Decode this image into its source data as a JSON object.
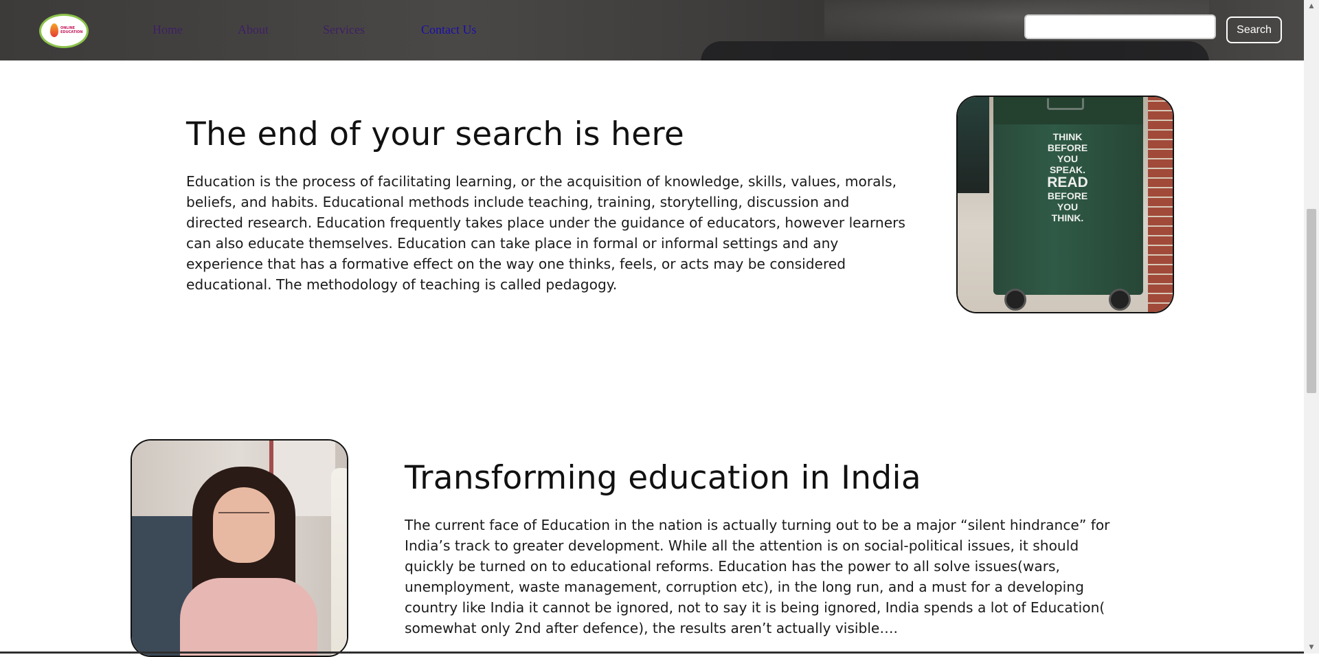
{
  "header": {
    "logo": {
      "lines": [
        "ONLINE",
        "EDUCATION"
      ]
    },
    "nav": {
      "home": "Home",
      "about": "About",
      "services": "Services",
      "contact": "Contact Us"
    },
    "search": {
      "value": "",
      "placeholder": "",
      "button_label": "Search"
    }
  },
  "sections": [
    {
      "title": "The end of your search is here",
      "text": "Education is the process of facilitating learning, or the acquisition of knowledge, skills, values, morals, beliefs, and habits. Educational methods include teaching, training, storytelling, discussion and directed research. Education frequently takes place under the guidance of educators, however learners can also educate themselves. Education can take place in formal or informal settings and any experience that has a formative effect on the way one thinks, feels, or acts may be considered educational. The methodology of teaching is called pedagogy.",
      "image": {
        "sign_lines": [
          "THINK",
          "BEFORE",
          "YOU",
          "SPEAK.",
          "READ",
          "BEFORE",
          "YOU",
          "THINK."
        ]
      }
    },
    {
      "title": "Transforming education in India",
      "text": "The current face of Education in the nation is actually turning out to be a major “silent hindrance” for India’s track to greater development. While all the attention is on social-political issues, it should quickly be turned on to educational reforms. Education has the power to all solve issues(wars, unemployment, waste management, corruption etc), in the long run, and a must for a developing country like India it cannot be ignored, not to say it is being ignored, India spends a lot of Education( somewhat only 2nd after defence), the results aren’t actually visible…."
    }
  ],
  "colors": {
    "nav_link": "#3d1f66",
    "nav_link_active": "#1a0dab",
    "header_bg": "#3d3b3a",
    "logo_border": "#8bc34a"
  },
  "icons": {
    "scroll_up": "▲",
    "scroll_down": "▼"
  }
}
